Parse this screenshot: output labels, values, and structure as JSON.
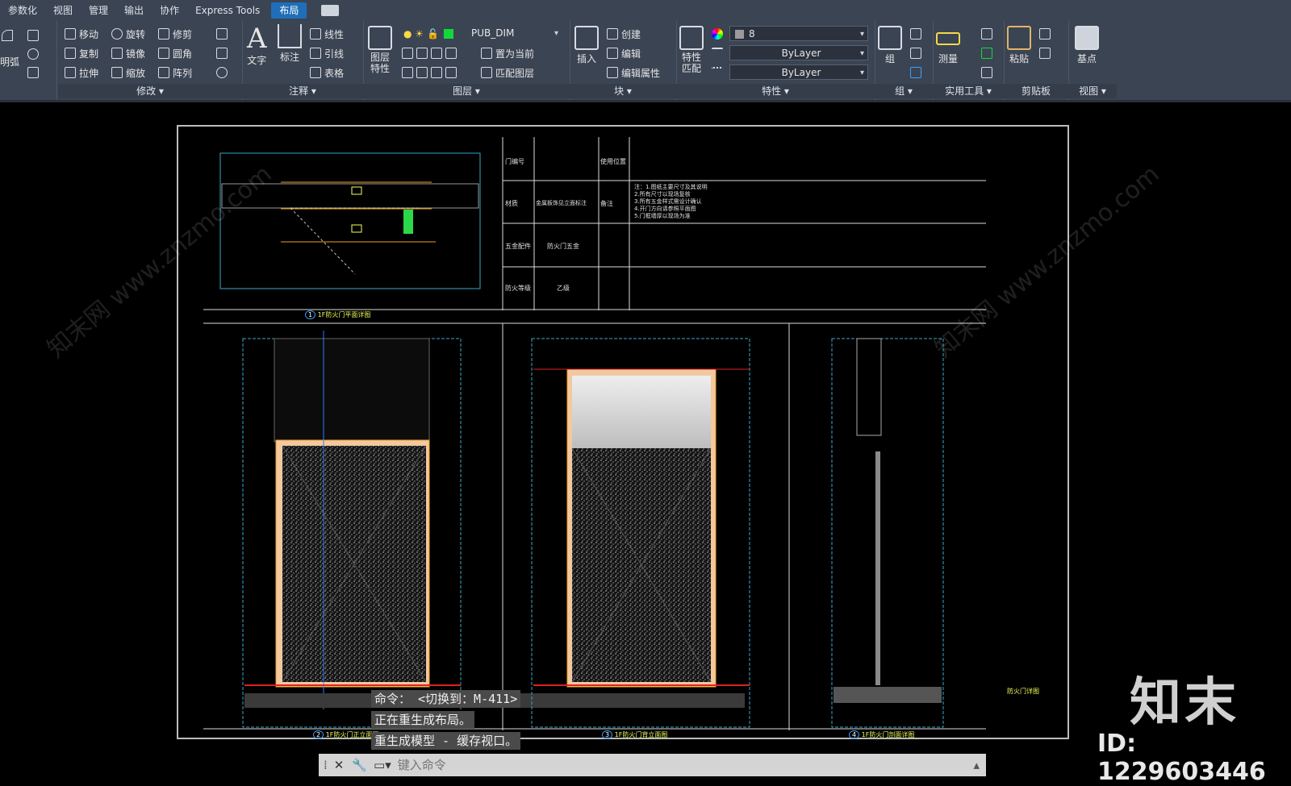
{
  "tabs": [
    "参数化",
    "视图",
    "管理",
    "输出",
    "协作",
    "Express Tools",
    "布局"
  ],
  "active_tab": "布局",
  "ribbon": {
    "panels": {
      "modify": "修改 ▾",
      "annotate": "注释 ▾",
      "layers": "图层 ▾",
      "block": "块 ▾",
      "properties": "特性 ▾",
      "group": "组 ▾",
      "utilities": "实用工具 ▾",
      "clipboard": "剪贴板",
      "view": "视图 ▾"
    },
    "draw_left": "明弧",
    "modify_tools": [
      "移动",
      "旋转",
      "修剪",
      "复制",
      "镜像",
      "圆角",
      "拉伸",
      "缩放",
      "阵列"
    ],
    "annotate": {
      "text": "文字",
      "dim": "标注",
      "leader_line": "线性",
      "leader": "引线",
      "table": "表格"
    },
    "layers": {
      "props": "图层\n特性",
      "current_layer": "PUB_DIM",
      "set_current": "置为当前",
      "match_layer": "匹配图层"
    },
    "block": {
      "insert": "插入",
      "create": "创建",
      "edit": "编辑",
      "edit_attr": "编辑属性"
    },
    "properties": {
      "match": "特性\n匹配",
      "color": "8",
      "linetype": "ByLayer",
      "lineweight": "ByLayer"
    },
    "group": {
      "group": "组"
    },
    "utilities": {
      "measure": "测量"
    },
    "clipboard": {
      "paste": "粘贴"
    },
    "view": {
      "base": "基点"
    }
  },
  "drawing": {
    "table": {
      "row1": {
        "label": "门编号",
        "label2": "使用位置"
      },
      "row2": {
        "label": "材质",
        "value": "金属板饰见立面标注",
        "label2": "备注",
        "notes": [
          "注：1.图纸主要尺寸及其说明",
          "2.所有尺寸以现场复核",
          "3.所有五金样式需设计确认",
          "4.开门方向请参照平面图",
          "5.门框墙厚以现场为准"
        ]
      },
      "row3": {
        "label": "五金配件",
        "value": "防火门五金"
      },
      "row4": {
        "label": "防火等级",
        "value": "乙级"
      }
    },
    "views": {
      "v1": {
        "num": "1",
        "title": "1F防火门平面详图"
      },
      "v2": {
        "num": "2",
        "title": "1F防火门正立面图"
      },
      "v3": {
        "num": "3",
        "title": "1F防火门背立面图"
      },
      "v4": {
        "num": "4",
        "title": "1F防火门剖面详图"
      }
    },
    "side_title": "防火门详图"
  },
  "command": {
    "lines": [
      "命令：  <切换到：M-411>",
      "正在重生成布局。",
      "重生成模型 - 缓存视口。"
    ],
    "placeholder": "键入命令"
  },
  "watermark": {
    "brand": "知末",
    "id": "ID: 1229603446",
    "text": "知末网 www.znzmo.com"
  }
}
